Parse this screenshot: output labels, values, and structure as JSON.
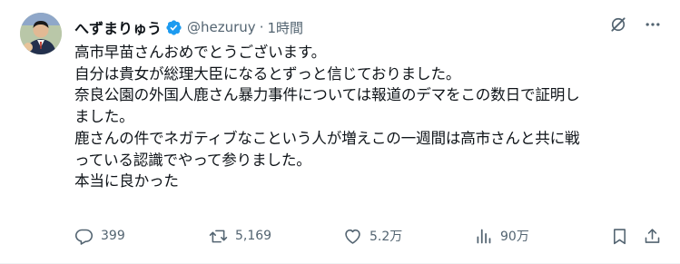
{
  "tweet": {
    "display_name": "へずまりゅう",
    "handle": "@hezuruy",
    "separator": "·",
    "time": "1時間",
    "lines": [
      "高市早苗さんおめでとうございます。",
      "自分は貴女が総理大臣になるとずっと信じておりました。",
      "奈良公園の外国人鹿さん暴力事件については報道のデマをこの数日で証明し",
      "ました。",
      "鹿さんの件でネガティブなこという人が増えこの一週間は高市さんと共に戦",
      "っている認識でやって参りました。",
      "本当に良かった"
    ],
    "verified": true
  },
  "actions": {
    "replies": "399",
    "retweets": "5,169",
    "likes": "5.2万",
    "views": "90万"
  },
  "icons": {
    "badge": "verified-badge-icon",
    "grok": "grok-icon",
    "more": "more-icon",
    "reply": "reply-icon",
    "retweet": "retweet-icon",
    "like": "heart-icon",
    "views": "views-icon",
    "bookmark": "bookmark-icon",
    "share": "share-icon"
  },
  "colors": {
    "text": "#0f1419",
    "secondary": "#536471",
    "verified": "#1d9bf0"
  }
}
